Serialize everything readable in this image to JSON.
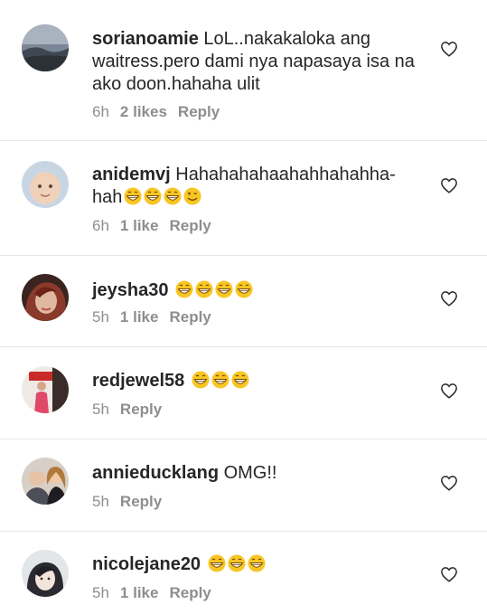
{
  "comments": [
    {
      "username": "sorianoamie",
      "text": " LoL..nakakaloka ang waitress.pero dami nya napasaya isa na ako doon.hahaha ulit",
      "time": "6h",
      "likes": "2 likes",
      "reply": "Reply",
      "emoji_count": 0
    },
    {
      "username": "anidemvj",
      "text": " Hahahahahaahahhahahha-hah",
      "time": "6h",
      "likes": "1 like",
      "reply": "Reply",
      "emojis": [
        "grin-emoji",
        "grin-emoji",
        "grin-emoji",
        "wink-emoji"
      ]
    },
    {
      "username": "jeysha30",
      "text": " ",
      "time": "5h",
      "likes": "1 like",
      "reply": "Reply",
      "emojis": [
        "grin-emoji",
        "grin-emoji",
        "grin-emoji",
        "grin-emoji"
      ]
    },
    {
      "username": "redjewel58",
      "text": " ",
      "time": "5h",
      "likes": "",
      "reply": "Reply",
      "emojis": [
        "grin-emoji",
        "grin-emoji",
        "grin-emoji"
      ]
    },
    {
      "username": "annieducklang",
      "text": " OMG!!",
      "time": "5h",
      "likes": "",
      "reply": "Reply",
      "emojis": []
    },
    {
      "username": "nicolejane20",
      "text": " ",
      "time": "5h",
      "likes": "1 like",
      "reply": "Reply",
      "emojis": [
        "grin-emoji",
        "grin-emoji",
        "grin-emoji"
      ]
    }
  ],
  "colors": {
    "text": "#262626",
    "meta": "#8e8e8e",
    "emoji": "#f7c624",
    "separator": "#e6e6e6"
  }
}
